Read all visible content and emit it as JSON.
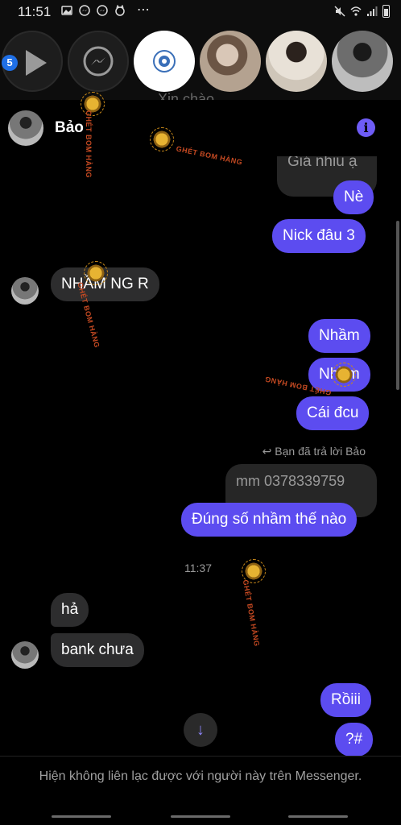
{
  "status_bar": {
    "time": "11:51",
    "left_icons": [
      "image-icon",
      "messenger-notification-icon",
      "messenger-notification-icon",
      "face-notification-icon",
      "more-dots-icon"
    ],
    "right_icons": [
      "mute-icon",
      "wifi-icon",
      "signal-icon",
      "battery-icon"
    ],
    "more": "⋯"
  },
  "chat_heads": {
    "badge_count": "5",
    "background_text": "Xin chào"
  },
  "header": {
    "contact_name": "Bảo",
    "info_symbol": "i"
  },
  "messages": {
    "partial_quote": "Giá nhiu ạ",
    "out_ne": "Nè",
    "out_nick": "Nick đâu 3",
    "in_nham_ng": "NHẦM NG R",
    "out_nham1": "Nhầm",
    "out_nham2": "Nhầm",
    "out_cai_dcu": "Cái đcu",
    "reply_note": "Bạn đã trả lời Bảo",
    "quoted_reply": "mm 0378339759",
    "out_dung_so": "Đúng số nhầm thế nào",
    "timestamp": "11:37",
    "in_ha": "hả",
    "in_bank": "bank chưa",
    "out_roiii": "Rồiii",
    "out_qhash": "?#"
  },
  "footer": {
    "notice": "Hiện không liên lạc được với người này trên Messenger."
  },
  "watermark": {
    "label": "GHÉT BOM HÀNG"
  },
  "colors": {
    "outgoing_bubble": "#5c4cf0",
    "incoming_bubble": "#2d2d2e",
    "accent": "#6e5cf6",
    "background": "#000000"
  }
}
